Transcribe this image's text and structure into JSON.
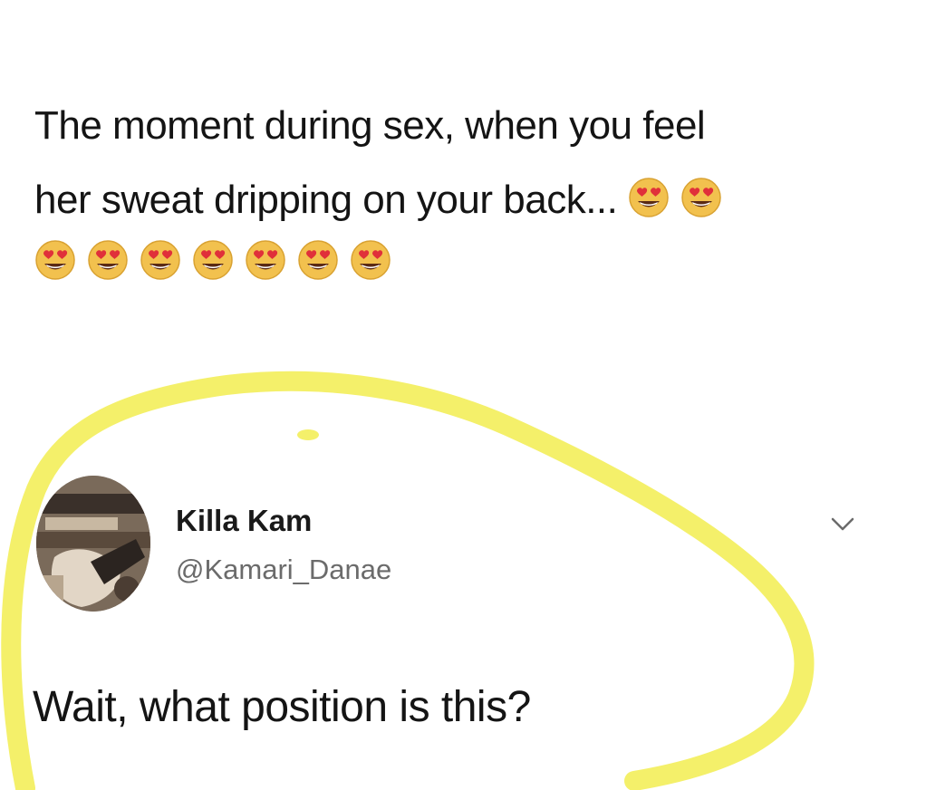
{
  "tweet": {
    "line1": "The moment during sex, when you feel",
    "line2": "her sweat dripping on your back...",
    "line2_emoji_count": 2,
    "line3_emoji_count": 7,
    "emoji": "smiling-face-with-heart-eyes-icon"
  },
  "reply": {
    "display_name": "Killa Kam",
    "handle": "@Kamari_Danae",
    "text": "Wait, what position is this?",
    "menu_icon": "chevron-down-icon",
    "avatar": "user-avatar-photo"
  },
  "colors": {
    "highlight": "#f4f06a",
    "emoji_face": "#f2c14e",
    "text": "#141414",
    "handle": "#6b6b6b"
  }
}
